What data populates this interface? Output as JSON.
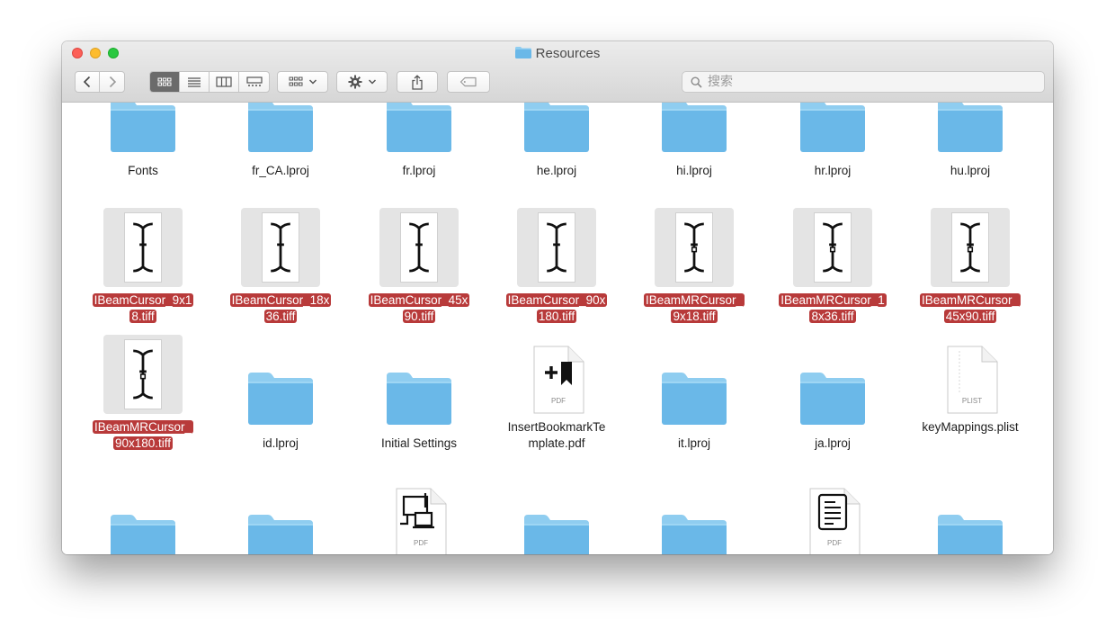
{
  "window": {
    "title": "Resources"
  },
  "toolbar": {
    "search_placeholder": "搜索",
    "colors": {
      "folder_top": "#8fcdf0",
      "folder_body": "#6ab8e8",
      "selection": "#b83a3a"
    }
  },
  "rows": [
    {
      "items": [
        {
          "name": "Fonts",
          "type": "folder",
          "selected": false
        },
        {
          "name": "fr_CA.lproj",
          "type": "folder",
          "selected": false
        },
        {
          "name": "fr.lproj",
          "type": "folder",
          "selected": false
        },
        {
          "name": "he.lproj",
          "type": "folder",
          "selected": false
        },
        {
          "name": "hi.lproj",
          "type": "folder",
          "selected": false
        },
        {
          "name": "hr.lproj",
          "type": "folder",
          "selected": false
        },
        {
          "name": "hu.lproj",
          "type": "folder",
          "selected": false
        }
      ]
    },
    {
      "items": [
        {
          "name": "IBeamCursor_9x1\n8.tiff",
          "type": "tiff",
          "selected": true
        },
        {
          "name": "IBeamCursor_18x\n36.tiff",
          "type": "tiff",
          "selected": true
        },
        {
          "name": "IBeamCursor_45x\n90.tiff",
          "type": "tiff",
          "selected": true
        },
        {
          "name": "IBeamCursor_90x\n180.tiff",
          "type": "tiff",
          "selected": true
        },
        {
          "name": "IBeamMRCursor_\n9x18.tiff",
          "type": "tiff-mr",
          "selected": true
        },
        {
          "name": "IBeamMRCursor_1\n8x36.tiff",
          "type": "tiff-mr",
          "selected": true
        },
        {
          "name": "IBeamMRCursor_\n45x90.tiff",
          "type": "tiff-mr",
          "selected": true
        }
      ]
    },
    {
      "items": [
        {
          "name": "IBeamMRCursor_\n90x180.tiff",
          "type": "tiff-mr",
          "selected": true
        },
        {
          "name": "id.lproj",
          "type": "folder",
          "selected": false
        },
        {
          "name": "Initial Settings",
          "type": "folder",
          "selected": false
        },
        {
          "name": "InsertBookmarkTe\nmplate.pdf",
          "type": "pdf-bookmark",
          "selected": false,
          "badge": "PDF"
        },
        {
          "name": "it.lproj",
          "type": "folder",
          "selected": false
        },
        {
          "name": "ja.lproj",
          "type": "folder",
          "selected": false
        },
        {
          "name": "keyMappings.plist",
          "type": "plist",
          "selected": false,
          "badge": "PLIST"
        }
      ]
    },
    {
      "items": [
        {
          "name": "",
          "type": "folder",
          "selected": false
        },
        {
          "name": "",
          "type": "folder",
          "selected": false
        },
        {
          "name": "",
          "type": "pdf-network",
          "selected": false,
          "badge": "PDF"
        },
        {
          "name": "",
          "type": "folder",
          "selected": false
        },
        {
          "name": "",
          "type": "folder",
          "selected": false
        },
        {
          "name": "",
          "type": "pdf-doc",
          "selected": false,
          "badge": "PDF"
        },
        {
          "name": "",
          "type": "folder",
          "selected": false
        }
      ]
    }
  ]
}
